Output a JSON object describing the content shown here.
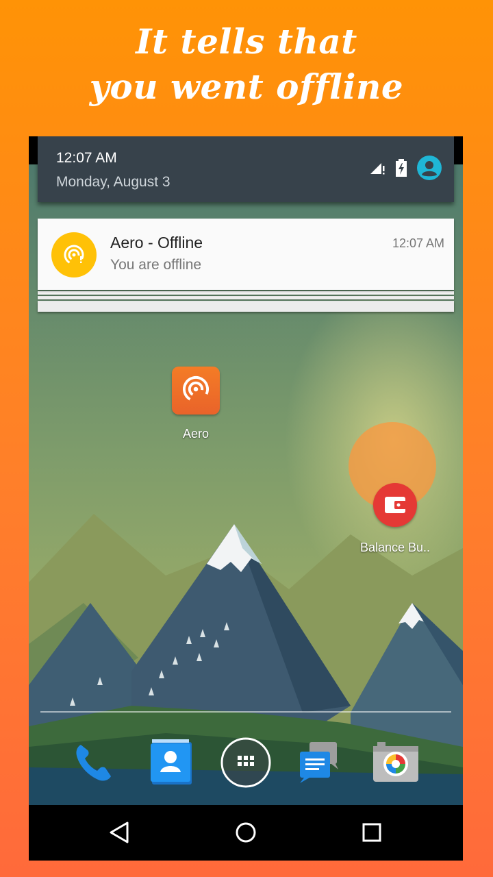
{
  "headline": {
    "line1": "It tells that",
    "line2": "you went offline"
  },
  "colors": {
    "background_top": "#ff9306",
    "background_bottom": "#ff6a3b",
    "shade": "#37424b",
    "notification_icon": "#ffc107",
    "aero_app": "#f47c26",
    "balance_app": "#e53935",
    "avatar": "#1fb6d6"
  },
  "status_shade": {
    "time": "12:07 AM",
    "date": "Monday, August 3",
    "icons": [
      "signal-no-sim-icon",
      "battery-charging-icon",
      "user-avatar-icon"
    ]
  },
  "notification": {
    "title": "Aero - Offline",
    "text": "You are offline",
    "time": "12:07 AM",
    "icon": "aero-signal-icon"
  },
  "home": {
    "apps": [
      {
        "label": "Aero",
        "icon": "aero-signal-icon"
      },
      {
        "label": "Balance Bu..",
        "icon": "wallet-icon"
      }
    ],
    "dock": [
      "phone-icon",
      "contacts-icon",
      "app-drawer-icon",
      "messenger-icon",
      "camera-icon"
    ]
  },
  "nav_bar": [
    "back-icon",
    "home-icon",
    "recents-icon"
  ]
}
